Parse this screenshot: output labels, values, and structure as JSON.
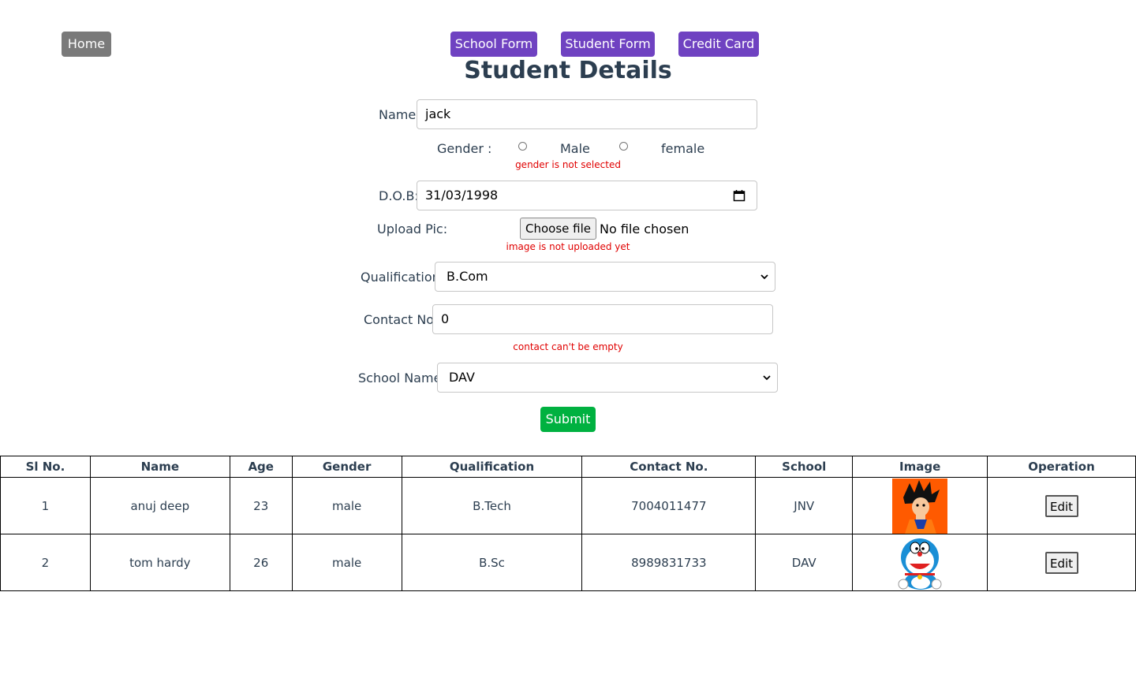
{
  "nav": {
    "home": "Home",
    "school_form": "School Form",
    "student_form": "Student Form",
    "credit_card": "Credit Card"
  },
  "title": "Student Details",
  "form": {
    "name_label": "Name:",
    "name_value": "jack",
    "gender_label": "Gender :",
    "gender_male": "Male",
    "gender_female": "female",
    "gender_error": "gender is not selected",
    "dob_label": "D.O.B:",
    "dob_value": "31/03/1998",
    "upload_label": "Upload Pic:",
    "choose_file": "Choose file",
    "no_file": "No file chosen",
    "image_error": "image is not uploaded yet",
    "qualification_label": "Qualification:",
    "qualification_value": "B.Com",
    "contact_label": "Contact No:",
    "contact_value": "0",
    "contact_error": "contact can't be empty",
    "school_label": "School Name:",
    "school_value": "DAV",
    "submit": "Submit"
  },
  "table": {
    "headers": [
      "Sl No.",
      "Name",
      "Age",
      "Gender",
      "Qualification",
      "Contact No.",
      "School",
      "Image",
      "Operation"
    ],
    "rows": [
      {
        "sl": "1",
        "name": "anuj deep",
        "age": "23",
        "gender": "male",
        "qualification": "B.Tech",
        "contact": "7004011477",
        "school": "JNV",
        "image": "goku-avatar",
        "action": "Edit"
      },
      {
        "sl": "2",
        "name": "tom hardy",
        "age": "26",
        "gender": "male",
        "qualification": "B.Sc",
        "contact": "8989831733",
        "school": "DAV",
        "image": "doraemon-avatar",
        "action": "Edit"
      }
    ]
  },
  "colors": {
    "nav_purple": "#6f42c1",
    "home_gray": "#7a7a7a",
    "submit_green": "#00b140",
    "error_red": "#e00000",
    "text": "#2c3e50"
  }
}
